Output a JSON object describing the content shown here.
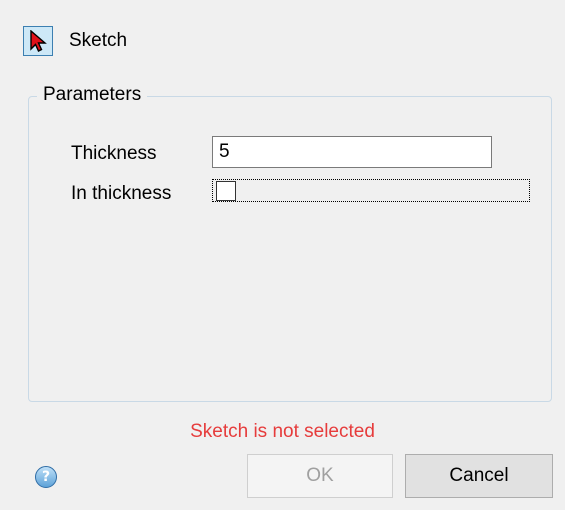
{
  "selector": {
    "icon": "cursor-arrow-icon",
    "label": "Sketch"
  },
  "parameters": {
    "title": "Parameters",
    "thickness_label": "Thickness",
    "thickness_value": "5",
    "in_thickness_label": "In thickness",
    "in_thickness_checked": false
  },
  "status": {
    "error_message": "Sketch is not selected",
    "error_color": "#e63c3c"
  },
  "footer": {
    "help_icon": "help-icon",
    "help_glyph": "?",
    "ok_label": "OK",
    "cancel_label": "Cancel"
  }
}
